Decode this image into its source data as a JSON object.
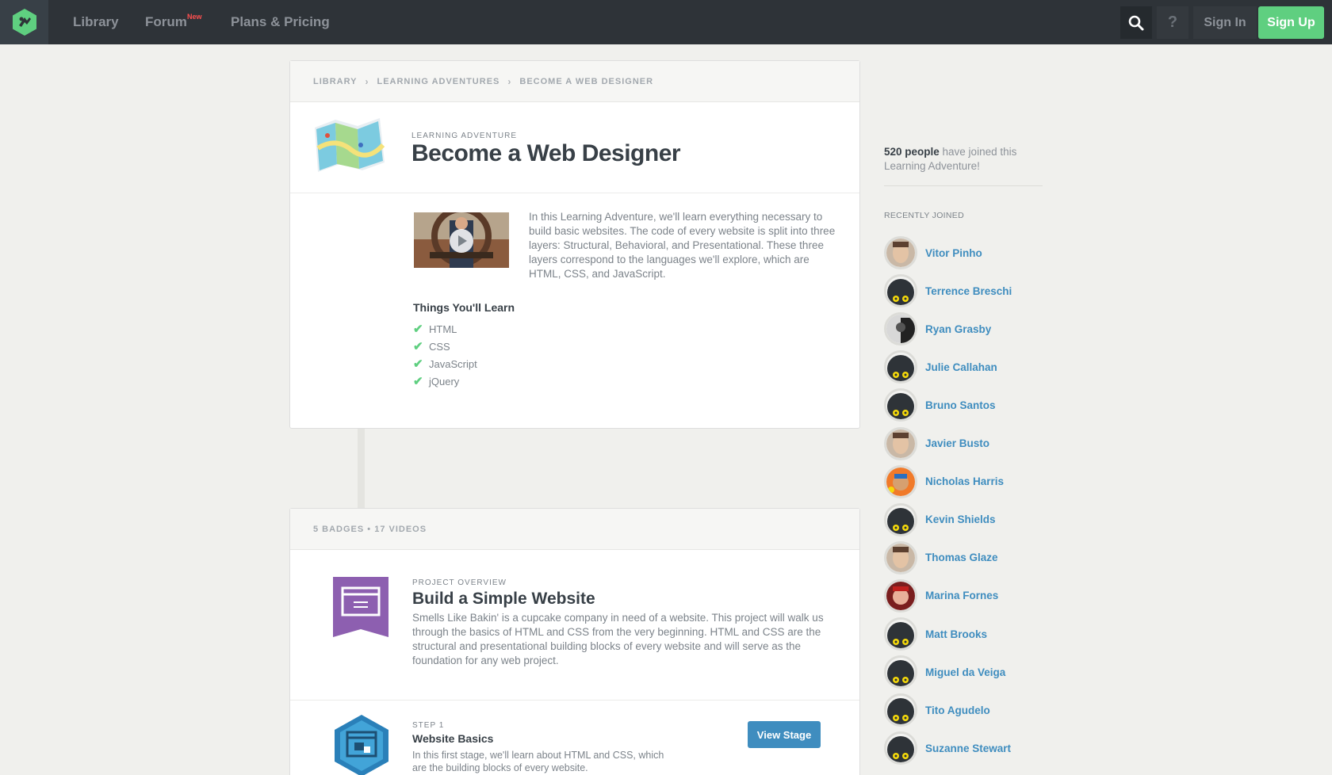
{
  "nav": {
    "logo_icon": "treehouse-logo-icon",
    "library": "Library",
    "forum": "Forum",
    "forum_badge": "New",
    "pricing": "Plans & Pricing",
    "search_icon": "search-icon",
    "help": "?",
    "sign_in": "Sign In",
    "sign_up": "Sign Up"
  },
  "breadcrumb": [
    "LIBRARY",
    "LEARNING ADVENTURES",
    "BECOME A WEB DESIGNER"
  ],
  "adventure": {
    "eyebrow": "LEARNING ADVENTURE",
    "title": "Become a Web Designer",
    "description": "In this Learning Adventure, we'll learn everything necessary to build basic websites. The code of every website is split into three layers: Structural, Behavioral, and Presentational. These three layers correspond to the languages we'll explore, which are HTML, CSS, and JavaScript.",
    "learn_title": "Things You'll Learn",
    "learn_items": [
      "HTML",
      "CSS",
      "JavaScript",
      "jQuery"
    ]
  },
  "course": {
    "summary": "5 BADGES • 17 VIDEOS",
    "project": {
      "eyebrow": "PROJECT OVERVIEW",
      "title": "Build a Simple Website",
      "description": "Smells Like Bakin' is a cupcake company in need of a website. This project will walk us through the basics of HTML and CSS from the very beginning. HTML and CSS are the structural and presentational building blocks of every website and will serve as the foundation for any web project."
    },
    "step": {
      "eyebrow": "STEP 1",
      "title": "Website Basics",
      "description": "In this first stage, we'll learn about HTML and CSS, which are the building blocks of every website.",
      "button": "View Stage"
    }
  },
  "sidebar": {
    "count": "520 people",
    "joined_text": " have joined this Learning Adventure!",
    "recent_label": "RECENTLY JOINED",
    "members": [
      {
        "name": "Vitor Pinho",
        "avatar": "photo-face"
      },
      {
        "name": "Terrence Breschi",
        "avatar": "default-owl"
      },
      {
        "name": "Ryan Grasby",
        "avatar": "photo-bw"
      },
      {
        "name": "Julie Callahan",
        "avatar": "default-owl"
      },
      {
        "name": "Bruno Santos",
        "avatar": "default-owl"
      },
      {
        "name": "Javier Busto",
        "avatar": "photo-face"
      },
      {
        "name": "Nicholas Harris",
        "avatar": "photo-colorful"
      },
      {
        "name": "Kevin Shields",
        "avatar": "default-owl"
      },
      {
        "name": "Thomas Glaze",
        "avatar": "photo-face"
      },
      {
        "name": "Marina Fornes",
        "avatar": "photo-red"
      },
      {
        "name": "Matt Brooks",
        "avatar": "default-owl"
      },
      {
        "name": "Miguel da Veiga",
        "avatar": "default-owl"
      },
      {
        "name": "Tito Agudelo",
        "avatar": "default-owl"
      },
      {
        "name": "Suzanne Stewart",
        "avatar": "default-owl"
      }
    ]
  },
  "colors": {
    "nav_bg": "#2e3338",
    "accent_green": "#5fcf80",
    "link_blue": "#3f8dbf",
    "project_purple": "#8d5fb0",
    "step_blue": "#2a80b9"
  }
}
